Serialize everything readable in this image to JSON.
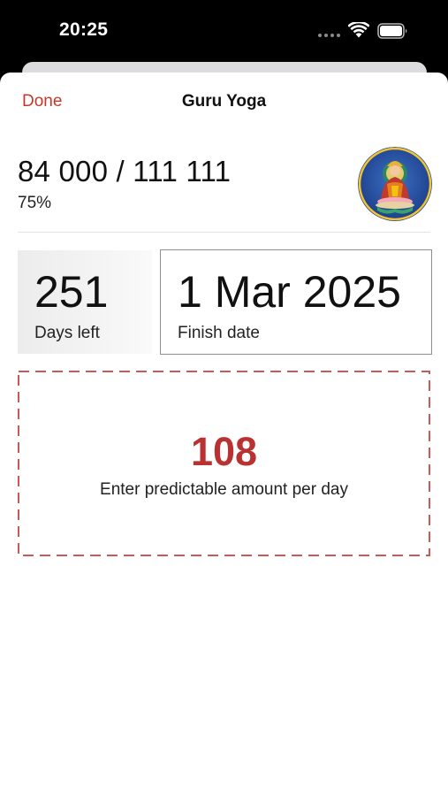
{
  "status_bar": {
    "time": "20:25"
  },
  "nav": {
    "done_label": "Done",
    "title": "Guru Yoga"
  },
  "progress": {
    "count_text": "84 000 / 111 111",
    "percent_text": "75%",
    "avatar_icon": "guru-portrait-icon"
  },
  "stats": {
    "days_left_value": "251",
    "days_left_label": "Days left",
    "finish_date_value": "1 Mar 2025",
    "finish_date_label": "Finish date"
  },
  "daily": {
    "value": "108",
    "hint": "Enter predictable amount per day"
  },
  "colors": {
    "accent_red": "#c0392b",
    "value_red": "#b83232",
    "dashed_border": "#c85a5a"
  }
}
